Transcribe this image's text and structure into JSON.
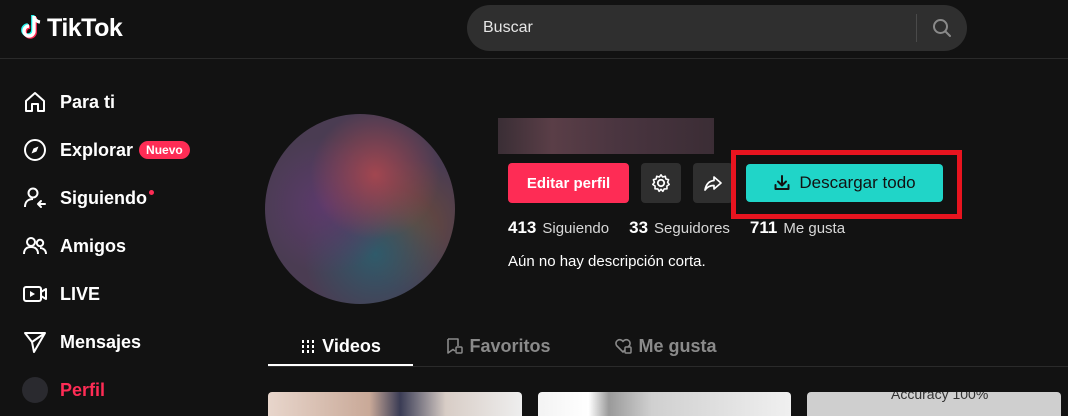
{
  "header": {
    "logo_text": "TikTok",
    "search_placeholder": "Buscar"
  },
  "sidebar": {
    "items": [
      {
        "label": "Para ti",
        "icon": "home-icon"
      },
      {
        "label": "Explorar",
        "icon": "compass-icon",
        "badge": "Nuevo"
      },
      {
        "label": "Siguiendo",
        "icon": "following-icon",
        "has_dot": true
      },
      {
        "label": "Amigos",
        "icon": "friends-icon"
      },
      {
        "label": "LIVE",
        "icon": "live-icon"
      },
      {
        "label": "Mensajes",
        "icon": "send-icon"
      },
      {
        "label": "Perfil",
        "icon": "avatar",
        "active": true
      }
    ]
  },
  "profile": {
    "edit_label": "Editar perfil",
    "download_label": "Descargar todo",
    "stats": [
      {
        "value": "413",
        "label": "Siguiendo"
      },
      {
        "value": "33",
        "label": "Seguidores"
      },
      {
        "value": "711",
        "label": "Me gusta"
      }
    ],
    "bio": "Aún no hay descripción corta."
  },
  "tabs": [
    {
      "label": "Videos",
      "icon": "grid-icon",
      "active": true
    },
    {
      "label": "Favoritos",
      "icon": "bookmark-icon"
    },
    {
      "label": "Me gusta",
      "icon": "heart-icon"
    }
  ],
  "thumbnails": {
    "third_text": "Accuracy 100%"
  },
  "colors": {
    "accent": "#fe2c55",
    "download": "#20d5c8",
    "highlight": "#e8141f",
    "background": "#121212"
  }
}
